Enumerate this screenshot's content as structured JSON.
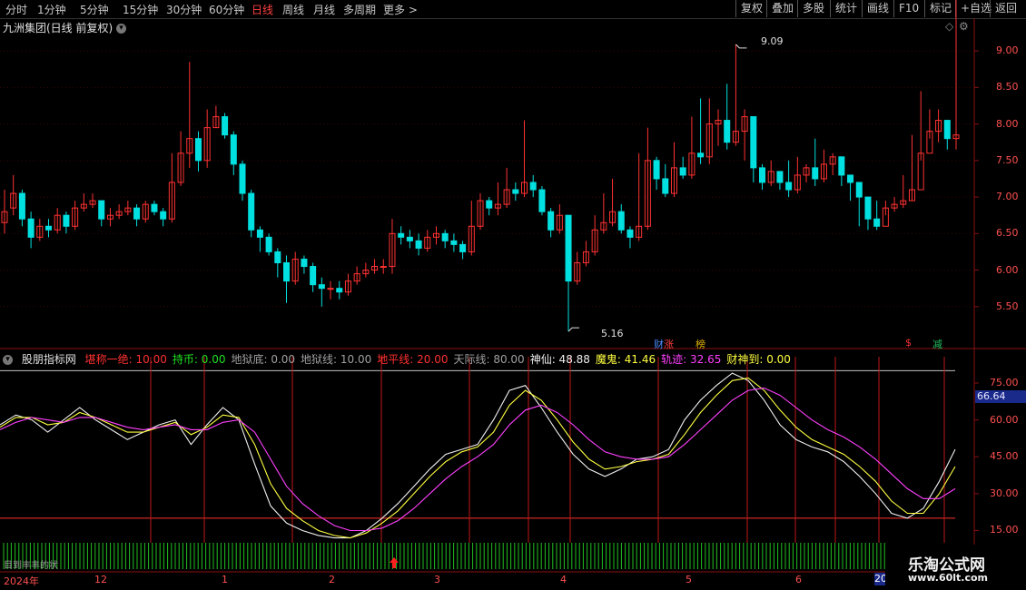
{
  "toolbar": {
    "periods": [
      "分时",
      "1分钟",
      "5分钟",
      "15分钟",
      "30分钟",
      "60分钟",
      "日线",
      "周线",
      "月线",
      "多周期",
      "更多 >"
    ],
    "active_period": "日线",
    "right_buttons": [
      "复权",
      "叠加",
      "多股",
      "统计",
      "画线",
      "F10",
      "标记",
      "+自选",
      "返回"
    ]
  },
  "main_chart": {
    "title": "九洲集团(日线 前复权)",
    "high_marker": "9.09",
    "low_marker": "5.16",
    "badges": [
      {
        "text": "财",
        "color": "#4a8cff"
      },
      {
        "text": "涨",
        "color": "#ff4040"
      },
      {
        "text": "榜",
        "color": "#e0b000"
      },
      {
        "text": "$",
        "color": "#ff3030"
      },
      {
        "text": "减",
        "color": "#20c060"
      }
    ],
    "y_ticks": [
      "9.00",
      "8.50",
      "8.00",
      "7.50",
      "7.00",
      "6.50",
      "6.00",
      "5.50"
    ]
  },
  "indicator": {
    "name": "股朋指标网",
    "fields": [
      {
        "label": "堪称一绝:",
        "value": "10.00",
        "color": "#ff3030"
      },
      {
        "label": "持币:",
        "value": "0.00",
        "color": "#20e020"
      },
      {
        "label": "地狱底:",
        "value": "0.00",
        "color": "#a0a0a0"
      },
      {
        "label": "地狱线:",
        "value": "10.00",
        "color": "#a0a0a0"
      },
      {
        "label": "地平线:",
        "value": "20.00",
        "color": "#ff3030"
      },
      {
        "label": "天际线:",
        "value": "80.00",
        "color": "#a0a0a0"
      },
      {
        "label": "神仙:",
        "value": "48.88",
        "color": "#f0f0f0"
      },
      {
        "label": "魔鬼:",
        "value": "41.46",
        "color": "#ffff40"
      },
      {
        "label": "轨迹:",
        "value": "32.65",
        "color": "#ff40ff"
      },
      {
        "label": "财神到:",
        "value": "0.00",
        "color": "#ffff40"
      }
    ],
    "y_ticks": [
      "75.00",
      "60.00",
      "45.00",
      "30.00",
      "15.00"
    ],
    "current_value": "66.64",
    "band_label": "目到丰丰的状"
  },
  "date_axis": [
    "2024年",
    "12",
    "1",
    "2",
    "3",
    "4",
    "5",
    "6",
    "20"
  ],
  "watermark": {
    "title": "乐淘公式网",
    "url": "www.60lt.com"
  },
  "colors": {
    "up": "#ff3232",
    "down": "#00e0e0",
    "grid": "#8a1010",
    "axis": "#c0c0c0"
  },
  "chart_data": [
    {
      "type": "candlestick",
      "title": "九洲集团(日线 前复权)",
      "ylim": [
        5.1,
        9.2
      ],
      "annotations": [
        {
          "text": "9.09",
          "kind": "high"
        },
        {
          "text": "5.16",
          "kind": "low"
        }
      ],
      "close": [
        6.8,
        7.05,
        6.7,
        6.45,
        6.6,
        6.55,
        6.75,
        6.6,
        6.85,
        6.9,
        6.95,
        6.7,
        6.75,
        6.8,
        6.85,
        6.7,
        6.9,
        6.8,
        6.7,
        7.2,
        7.6,
        7.8,
        7.5,
        7.95,
        8.1,
        7.85,
        7.45,
        7.05,
        6.55,
        6.45,
        6.25,
        6.1,
        5.85,
        6.15,
        6.05,
        5.8,
        5.75,
        5.75,
        5.7,
        5.85,
        5.95,
        6.0,
        6.05,
        6.05,
        6.5,
        6.45,
        6.4,
        6.3,
        6.45,
        6.5,
        6.4,
        6.35,
        6.25,
        6.6,
        6.95,
        6.85,
        6.9,
        7.1,
        7.05,
        7.2,
        7.1,
        6.8,
        6.55,
        6.75,
        5.85,
        6.1,
        6.25,
        6.55,
        6.65,
        6.8,
        6.55,
        6.45,
        6.6,
        7.5,
        7.25,
        7.05,
        7.4,
        7.3,
        7.6,
        7.55,
        8.0,
        8.05,
        7.75,
        7.9,
        8.1,
        7.4,
        7.2,
        7.35,
        7.2,
        7.1,
        7.3,
        7.4,
        7.25,
        7.45,
        7.55,
        7.3,
        7.2,
        7.0,
        6.7,
        6.6,
        6.85,
        6.9,
        6.95,
        7.1,
        7.6,
        7.9,
        8.05,
        7.8,
        7.85
      ],
      "open": [
        6.65,
        6.85,
        7.05,
        6.7,
        6.45,
        6.6,
        6.55,
        6.75,
        6.6,
        6.85,
        6.9,
        6.95,
        6.7,
        6.75,
        6.8,
        6.85,
        6.7,
        6.9,
        6.8,
        6.7,
        7.2,
        7.6,
        7.8,
        7.5,
        7.95,
        8.1,
        7.85,
        7.45,
        7.05,
        6.55,
        6.45,
        6.25,
        6.1,
        5.85,
        6.15,
        6.05,
        5.8,
        5.75,
        5.75,
        5.7,
        5.85,
        5.95,
        6.0,
        6.05,
        6.05,
        6.5,
        6.45,
        6.4,
        6.3,
        6.45,
        6.5,
        6.4,
        6.35,
        6.25,
        6.6,
        6.95,
        6.85,
        6.9,
        7.1,
        7.05,
        7.2,
        7.1,
        6.8,
        6.55,
        6.75,
        5.85,
        6.1,
        6.25,
        6.55,
        6.65,
        6.8,
        6.55,
        6.45,
        6.6,
        7.5,
        7.25,
        7.05,
        7.4,
        7.3,
        7.6,
        7.55,
        8.0,
        8.05,
        7.75,
        7.9,
        8.1,
        7.4,
        7.2,
        7.35,
        7.2,
        7.1,
        7.3,
        7.4,
        7.25,
        7.45,
        7.55,
        7.3,
        7.2,
        7.0,
        6.7,
        6.6,
        6.85,
        6.9,
        6.95,
        7.1,
        7.6,
        7.9,
        8.05,
        7.8
      ],
      "high": [
        7.1,
        7.3,
        7.1,
        6.8,
        6.7,
        6.7,
        6.85,
        6.8,
        6.95,
        7.05,
        7.05,
        6.95,
        6.85,
        6.9,
        6.95,
        6.9,
        6.95,
        6.95,
        6.85,
        7.6,
        7.9,
        8.85,
        7.9,
        8.2,
        8.25,
        8.15,
        7.9,
        7.5,
        7.1,
        6.6,
        6.5,
        6.3,
        6.2,
        6.25,
        6.2,
        6.1,
        5.9,
        5.85,
        5.85,
        5.95,
        6.05,
        6.1,
        6.15,
        6.15,
        6.7,
        6.6,
        6.55,
        6.5,
        6.55,
        6.6,
        6.55,
        6.5,
        6.4,
        6.95,
        7.05,
        7.0,
        7.2,
        7.4,
        7.2,
        8.05,
        7.3,
        7.15,
        6.85,
        6.9,
        6.75,
        6.25,
        6.4,
        6.75,
        7.05,
        7.25,
        6.9,
        6.6,
        7.6,
        7.95,
        7.55,
        7.45,
        7.75,
        7.55,
        8.1,
        8.35,
        8.35,
        8.2,
        8.55,
        9.09,
        8.2,
        7.55,
        7.45,
        7.5,
        7.3,
        7.5,
        7.55,
        7.45,
        7.8,
        7.65,
        7.6,
        7.5,
        7.3,
        7.05,
        6.85,
        6.95,
        6.95,
        7.0,
        7.3,
        7.85,
        8.45,
        8.2,
        8.2,
        7.95
      ],
      "low": [
        6.5,
        6.75,
        6.6,
        6.3,
        6.4,
        6.45,
        6.5,
        6.5,
        6.55,
        6.8,
        6.85,
        6.6,
        6.6,
        6.7,
        6.75,
        6.6,
        6.65,
        6.75,
        6.6,
        6.65,
        7.15,
        7.4,
        7.35,
        7.4,
        7.95,
        7.8,
        7.3,
        6.95,
        6.45,
        6.25,
        6.2,
        5.9,
        5.55,
        5.8,
        5.95,
        5.7,
        5.5,
        5.6,
        5.6,
        5.65,
        5.8,
        5.9,
        5.95,
        5.95,
        5.95,
        6.35,
        6.3,
        6.2,
        6.25,
        6.35,
        6.3,
        6.25,
        6.15,
        6.2,
        6.55,
        6.75,
        6.75,
        6.85,
        6.95,
        7.0,
        7.0,
        6.75,
        6.45,
        6.5,
        5.16,
        5.8,
        6.05,
        6.2,
        6.5,
        6.6,
        6.5,
        6.3,
        6.4,
        6.55,
        7.1,
        7.0,
        7.0,
        7.25,
        7.25,
        7.45,
        7.45,
        7.7,
        7.65,
        7.7,
        7.5,
        7.2,
        7.1,
        7.15,
        7.1,
        7.0,
        7.05,
        7.2,
        7.15,
        7.2,
        7.3,
        7.15,
        6.95,
        6.6,
        6.55,
        6.55,
        6.75,
        6.8,
        6.85,
        6.95,
        7.5,
        7.8,
        7.75,
        7.65,
        7.65
      ]
    },
    {
      "type": "line",
      "title": "股朋指标网",
      "ylim": [
        10,
        80
      ],
      "reference_lines": {
        "天际线": 80,
        "地平线": 20,
        "地狱线": 10
      },
      "series": [
        {
          "name": "神仙",
          "color": "#f0f0f0",
          "values": [
            58,
            62,
            60,
            55,
            60,
            65,
            60,
            56,
            52,
            55,
            58,
            60,
            50,
            58,
            65,
            60,
            42,
            25,
            18,
            15,
            13,
            12,
            12,
            15,
            20,
            26,
            33,
            40,
            46,
            48,
            50,
            60,
            72,
            74,
            65,
            55,
            46,
            40,
            37,
            40,
            44,
            45,
            48,
            60,
            68,
            74,
            79,
            76,
            68,
            58,
            52,
            49,
            47,
            43,
            37,
            30,
            22,
            20,
            24,
            35,
            48
          ]
        },
        {
          "name": "魔鬼",
          "color": "#ffff40",
          "values": [
            57,
            61,
            61,
            58,
            59,
            63,
            61,
            58,
            55,
            55,
            57,
            59,
            54,
            57,
            62,
            61,
            50,
            34,
            24,
            19,
            15,
            13,
            12,
            14,
            18,
            23,
            30,
            37,
            43,
            47,
            49,
            55,
            66,
            72,
            68,
            60,
            51,
            44,
            40,
            41,
            43,
            44,
            46,
            54,
            63,
            70,
            76,
            77,
            72,
            64,
            57,
            52,
            49,
            46,
            41,
            35,
            27,
            22,
            22,
            30,
            41
          ]
        },
        {
          "name": "轨迹",
          "color": "#ff40ff",
          "values": [
            56,
            59,
            61,
            60,
            59,
            61,
            61,
            59,
            57,
            56,
            57,
            58,
            56,
            56,
            59,
            60,
            55,
            44,
            33,
            26,
            21,
            17,
            15,
            15,
            16,
            19,
            24,
            30,
            36,
            41,
            45,
            50,
            58,
            64,
            66,
            63,
            58,
            52,
            47,
            45,
            44,
            44,
            45,
            50,
            56,
            62,
            68,
            72,
            73,
            70,
            65,
            60,
            56,
            53,
            49,
            44,
            38,
            32,
            28,
            28,
            32
          ]
        }
      ]
    }
  ]
}
